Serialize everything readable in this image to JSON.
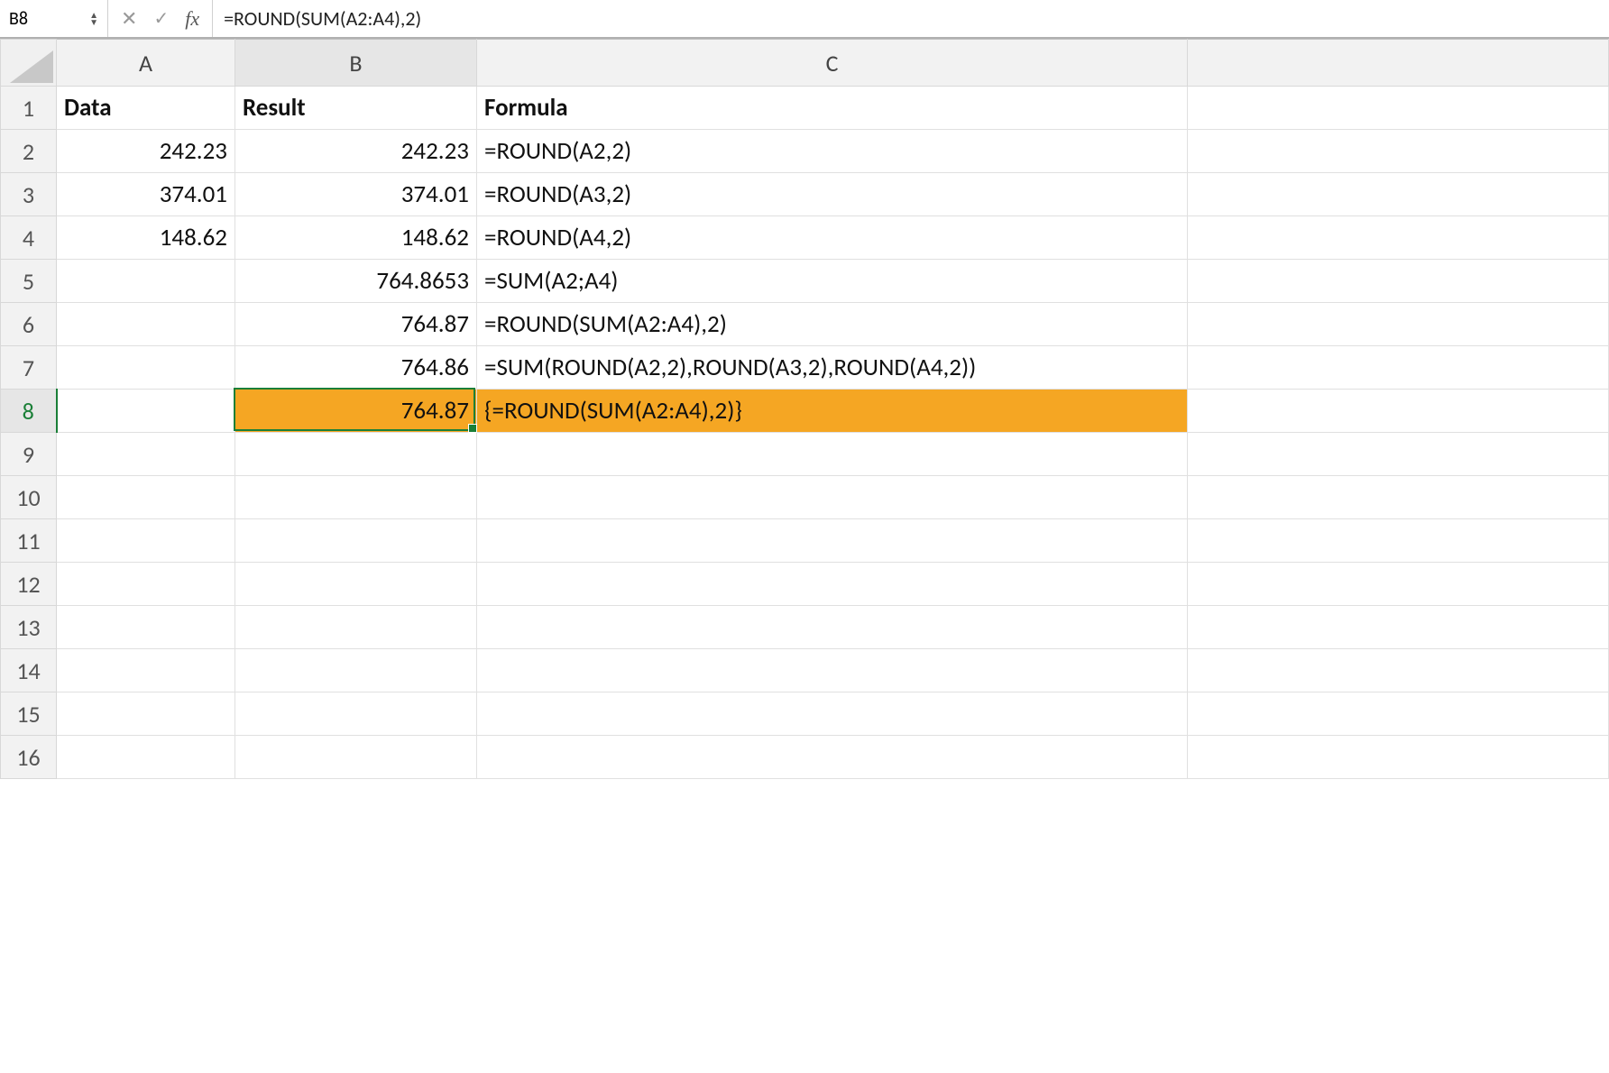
{
  "formula_bar": {
    "name_box": "B8",
    "fx_label": "fx",
    "formula": "=ROUND(SUM(A2:A4),2)"
  },
  "columns": [
    "A",
    "B",
    "C"
  ],
  "active_column": "B",
  "active_row": 8,
  "selected_cell": "B8",
  "row_count": 16,
  "headers": {
    "A": "Data",
    "B": "Result",
    "C": "Formula"
  },
  "rows": [
    {
      "n": 2,
      "A": "242.23",
      "B": "242.23",
      "C": "=ROUND(A2,2)"
    },
    {
      "n": 3,
      "A": "374.01",
      "B": "374.01",
      "C": "=ROUND(A3,2)"
    },
    {
      "n": 4,
      "A": "148.62",
      "B": "148.62",
      "C": "=ROUND(A4,2)"
    },
    {
      "n": 5,
      "A": "",
      "B": "764.8653",
      "C": "=SUM(A2;A4)"
    },
    {
      "n": 6,
      "A": "",
      "B": "764.87",
      "C": "=ROUND(SUM(A2:A4),2)"
    },
    {
      "n": 7,
      "A": "",
      "B": "764.86",
      "C": "=SUM(ROUND(A2,2),ROUND(A3,2),ROUND(A4,2))"
    },
    {
      "n": 8,
      "A": "",
      "B": "764.87",
      "C": "{=ROUND(SUM(A2:A4),2)}",
      "highlight": true
    }
  ],
  "highlight_color": "#f5a623",
  "selection_outline_color": "#1a7f37"
}
